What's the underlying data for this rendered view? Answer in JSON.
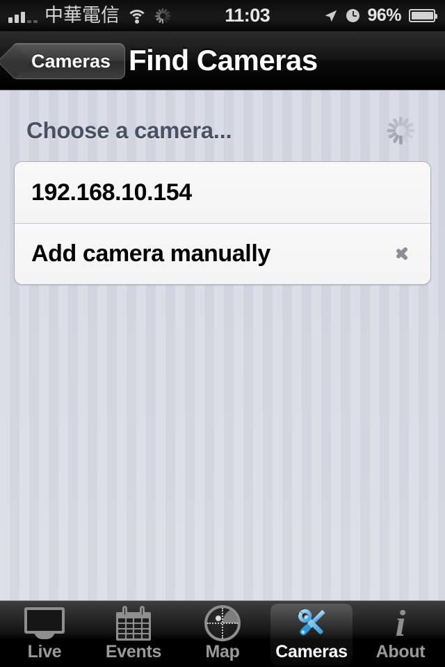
{
  "status_bar": {
    "carrier": "中華電信",
    "time": "11:03",
    "battery_percent": "96%",
    "icons": {
      "signal": "signal-bars-icon",
      "wifi": "wifi-icon",
      "activity": "activity-spinner-icon",
      "location": "location-arrow-icon",
      "alarm": "alarm-clock-icon",
      "battery": "battery-icon"
    }
  },
  "nav_bar": {
    "back_label": "Cameras",
    "title": "Find Cameras"
  },
  "content": {
    "section_title": "Choose a camera...",
    "loading_spinner": "activity-spinner-icon",
    "cells": [
      {
        "label": "192.168.10.154",
        "accessory": "none"
      },
      {
        "label": "Add camera manually",
        "accessory": "disclosure-chevron"
      }
    ]
  },
  "tab_bar": {
    "selected_index": 3,
    "tabs": [
      {
        "label": "Live",
        "icon": "monitor-icon"
      },
      {
        "label": "Events",
        "icon": "calendar-icon"
      },
      {
        "label": "Map",
        "icon": "radar-icon"
      },
      {
        "label": "Cameras",
        "icon": "tools-icon"
      },
      {
        "label": "About",
        "icon": "info-icon"
      }
    ]
  },
  "colors": {
    "background": "#d4d8e2",
    "nav_bar": "#141414",
    "section_title": "#4a5163",
    "cell_background": "#f6f6f6",
    "accent_selected": "#5bb5ef",
    "tab_label": "#9a9a9a",
    "tab_label_selected": "#ffffff"
  }
}
